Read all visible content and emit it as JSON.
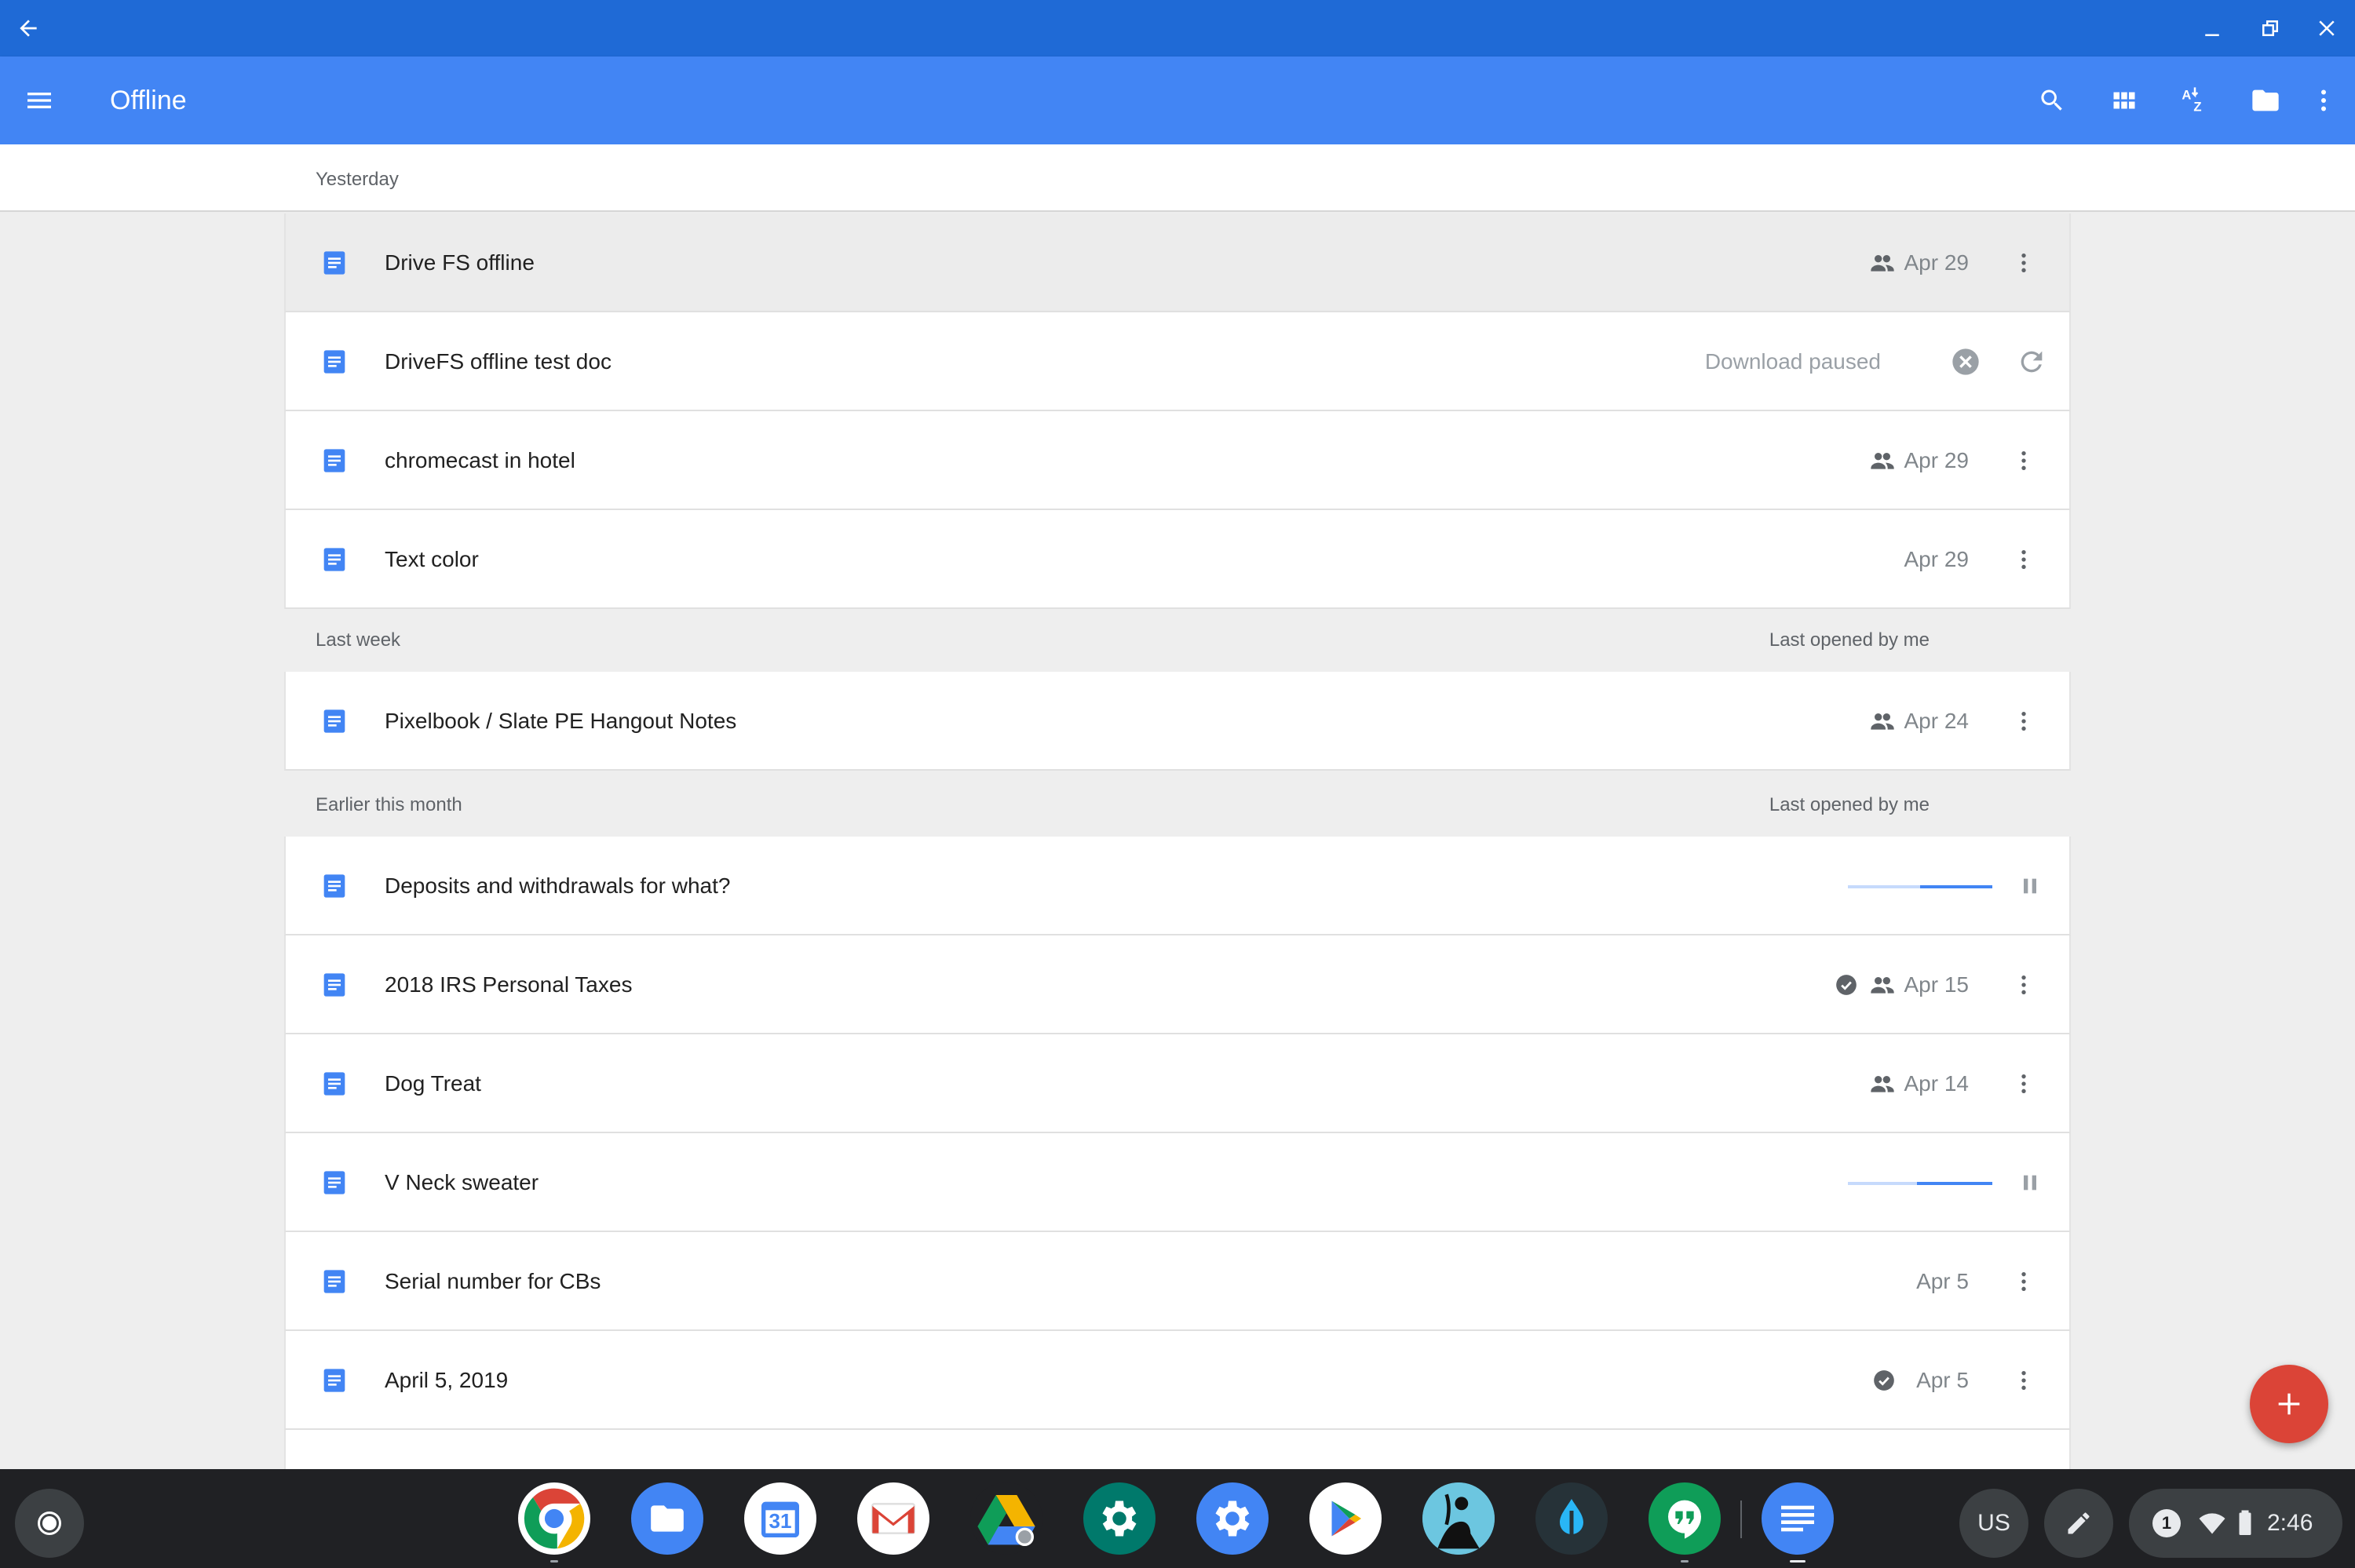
{
  "app": {
    "title": "Offline",
    "primary_color": "#4285f4",
    "titlebar_color": "#1f6ad6"
  },
  "titlebar": {
    "back_icon": "arrow-back-icon",
    "minimize_icon": "minimize-icon",
    "restore_icon": "restore-icon",
    "close_icon": "close-icon"
  },
  "toolbar": {
    "menu_icon": "hamburger-icon",
    "actions": [
      "search-icon",
      "grid-view-icon",
      "sort-az-icon",
      "folder-icon",
      "more-vert-icon"
    ]
  },
  "sections": [
    {
      "label": "Yesterday",
      "right": "",
      "rows": [
        {
          "name": "Drive FS offline",
          "date": "Apr 29",
          "shared": true,
          "offline": false,
          "state": "selected"
        },
        {
          "name": "DriveFS offline test doc",
          "status": "Download paused",
          "state": "paused"
        },
        {
          "name": "chromecast in hotel",
          "date": "Apr 29",
          "shared": true,
          "offline": false,
          "state": "normal"
        },
        {
          "name": "Text color",
          "date": "Apr 29",
          "shared": false,
          "offline": false,
          "state": "normal"
        }
      ]
    },
    {
      "label": "Last week",
      "right": "Last opened by me",
      "rows": [
        {
          "name": "Pixelbook / Slate PE Hangout Notes",
          "date": "Apr 24",
          "shared": true,
          "offline": false,
          "state": "normal"
        }
      ]
    },
    {
      "label": "Earlier this month",
      "right": "Last opened by me",
      "rows": [
        {
          "name": "Deposits and withdrawals for what?",
          "state": "downloading",
          "progress": 0.5
        },
        {
          "name": "2018 IRS Personal Taxes",
          "date": "Apr 15",
          "shared": true,
          "offline": true,
          "state": "normal"
        },
        {
          "name": "Dog Treat",
          "date": "Apr 14",
          "shared": true,
          "offline": false,
          "state": "normal"
        },
        {
          "name": "V Neck sweater",
          "state": "downloading",
          "progress": 0.52
        },
        {
          "name": "Serial number for CBs",
          "date": "Apr 5",
          "shared": false,
          "offline": false,
          "state": "normal"
        },
        {
          "name": "April 5, 2019",
          "date": "Apr 5",
          "shared": false,
          "offline": true,
          "state": "normal"
        }
      ]
    }
  ],
  "fab": {
    "icon": "add-icon",
    "color": "#db4437"
  },
  "shelf": {
    "apps": [
      "chrome-icon",
      "files-icon",
      "calendar-icon",
      "gmail-icon",
      "drive-icon",
      "settings-teal-icon",
      "settings-icon",
      "play-store-icon",
      "kindle-icon",
      "dark-app-icon",
      "hangouts-icon",
      "docs-icon"
    ],
    "calendar_day": "31",
    "ime": "US",
    "notification_count": "1",
    "time": "2:46"
  }
}
